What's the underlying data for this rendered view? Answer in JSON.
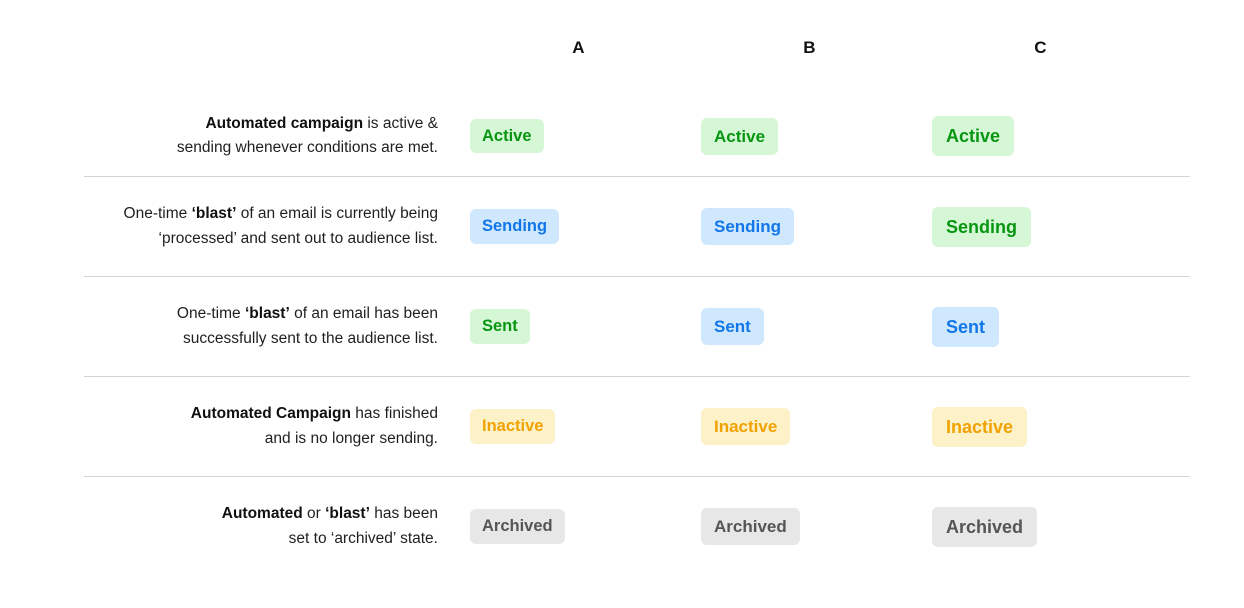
{
  "columns": [
    {
      "label": "A",
      "size": "size-a"
    },
    {
      "label": "B",
      "size": "size-b"
    },
    {
      "label": "C",
      "size": "size-c"
    }
  ],
  "colors": {
    "green_bg": "#d6f7d6",
    "green_fg": "#089612",
    "blue_bg": "#cfe8fd",
    "blue_fg": "#1277e8",
    "yellow_bg": "#fdf1c8",
    "yellow_fg": "#f0a202",
    "grey_bg": "#e7e7e7",
    "grey_fg": "#555555",
    "divider": "#d4d4d4",
    "text": "#1f1f1f"
  },
  "rows": [
    {
      "description_line1_bold": "Automated campaign",
      "description_line1_rest": " is active &",
      "description_line2": "sending whenever conditions are met.",
      "badges": [
        {
          "label": "Active",
          "tone": "tone-green"
        },
        {
          "label": "Active",
          "tone": "tone-green"
        },
        {
          "label": "Active",
          "tone": "tone-green"
        }
      ]
    },
    {
      "description_line1_pre": "One-time ",
      "description_line1_bold": "‘blast’",
      "description_line1_rest": " of an email is currently being",
      "description_line2": "‘processed’ and sent out to audience list.",
      "badges": [
        {
          "label": "Sending",
          "tone": "tone-blue"
        },
        {
          "label": "Sending",
          "tone": "tone-blue"
        },
        {
          "label": "Sending",
          "tone": "tone-green"
        }
      ]
    },
    {
      "description_line1_pre": "One-time ",
      "description_line1_bold": "‘blast’",
      "description_line1_rest": " of an email has been",
      "description_line2": "successfully sent to the audience list.",
      "badges": [
        {
          "label": "Sent",
          "tone": "tone-green"
        },
        {
          "label": "Sent",
          "tone": "tone-blue"
        },
        {
          "label": "Sent",
          "tone": "tone-blue"
        }
      ]
    },
    {
      "description_line1_bold": "Automated Campaign",
      "description_line1_rest": " has finished",
      "description_line2": "and is no longer sending.",
      "badges": [
        {
          "label": "Inactive",
          "tone": "tone-yellow"
        },
        {
          "label": "Inactive",
          "tone": "tone-yellow"
        },
        {
          "label": "Inactive",
          "tone": "tone-yellow"
        }
      ]
    },
    {
      "description_line1_bold": "Automated",
      "description_line1_mid": " or ",
      "description_line1_bold2": "‘blast’",
      "description_line1_rest": " has been",
      "description_line2": "set to ‘archived’ state.",
      "badges": [
        {
          "label": "Archived",
          "tone": "tone-grey"
        },
        {
          "label": "Archived",
          "tone": "tone-grey"
        },
        {
          "label": "Archived",
          "tone": "tone-grey"
        }
      ]
    }
  ]
}
